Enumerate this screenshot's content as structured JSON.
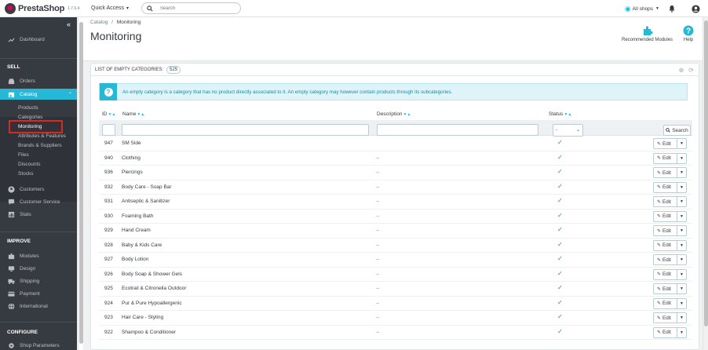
{
  "header": {
    "brand": "PrestaShop",
    "version": "1.7.6.4",
    "quick_access": "Quick Access",
    "search_placeholder": "Search",
    "shops": "All shops"
  },
  "sidebar": {
    "dashboard": "Dashboard",
    "sell_head": "SELL",
    "orders": "Orders",
    "catalog": "Catalog",
    "catalog_sub": [
      "Products",
      "Categories",
      "Monitoring",
      "Attributes & Features",
      "Brands & Suppliers",
      "Files",
      "Discounts",
      "Stocks"
    ],
    "customers": "Customers",
    "customer_service": "Customer Service",
    "stats": "Stats",
    "improve_head": "IMPROVE",
    "modules": "Modules",
    "design": "Design",
    "shipping": "Shipping",
    "payment": "Payment",
    "international": "International",
    "configure_head": "CONFIGURE",
    "shop_parameters": "Shop Parameters"
  },
  "page": {
    "crumb_parent": "Catalog",
    "crumb_sep": "/",
    "crumb_current": "Monitoring",
    "title": "Monitoring",
    "tool_modules": "Recommended Modules",
    "tool_help": "Help"
  },
  "panel": {
    "title": "LIST OF EMPTY CATEGORIES:",
    "count": "525",
    "alert": "An empty category is a category that has no product directly associated to it. An empty category may however contain products through its subcategories.",
    "col_id": "ID",
    "col_name": "Name",
    "col_desc": "Description",
    "col_status": "Status",
    "status_filter": "-",
    "search_btn": "Search",
    "edit_label": "Edit"
  },
  "rows": [
    {
      "id": "947",
      "name": "SM Side",
      "desc": ""
    },
    {
      "id": "940",
      "name": "Clothing",
      "desc": "--"
    },
    {
      "id": "936",
      "name": "Piercings",
      "desc": "--"
    },
    {
      "id": "932",
      "name": "Body Care - Soap Bar",
      "desc": "--"
    },
    {
      "id": "931",
      "name": "Antiseptic & Sanitizer",
      "desc": "--"
    },
    {
      "id": "930",
      "name": "Foaming Bath",
      "desc": "--"
    },
    {
      "id": "929",
      "name": "Hand Cream",
      "desc": "--"
    },
    {
      "id": "928",
      "name": "Baby & Kids Care",
      "desc": "--"
    },
    {
      "id": "927",
      "name": "Body Lotion",
      "desc": "--"
    },
    {
      "id": "926",
      "name": "Body Soap & Shower Gels",
      "desc": "--"
    },
    {
      "id": "925",
      "name": "Ecotrail & Citronella Outdoor",
      "desc": "--"
    },
    {
      "id": "924",
      "name": "Pur & Pure Hypoallergenic",
      "desc": "--"
    },
    {
      "id": "923",
      "name": "Hair Care - Styling",
      "desc": "--"
    },
    {
      "id": "922",
      "name": "Shampoo & Conditioner",
      "desc": "--"
    }
  ]
}
